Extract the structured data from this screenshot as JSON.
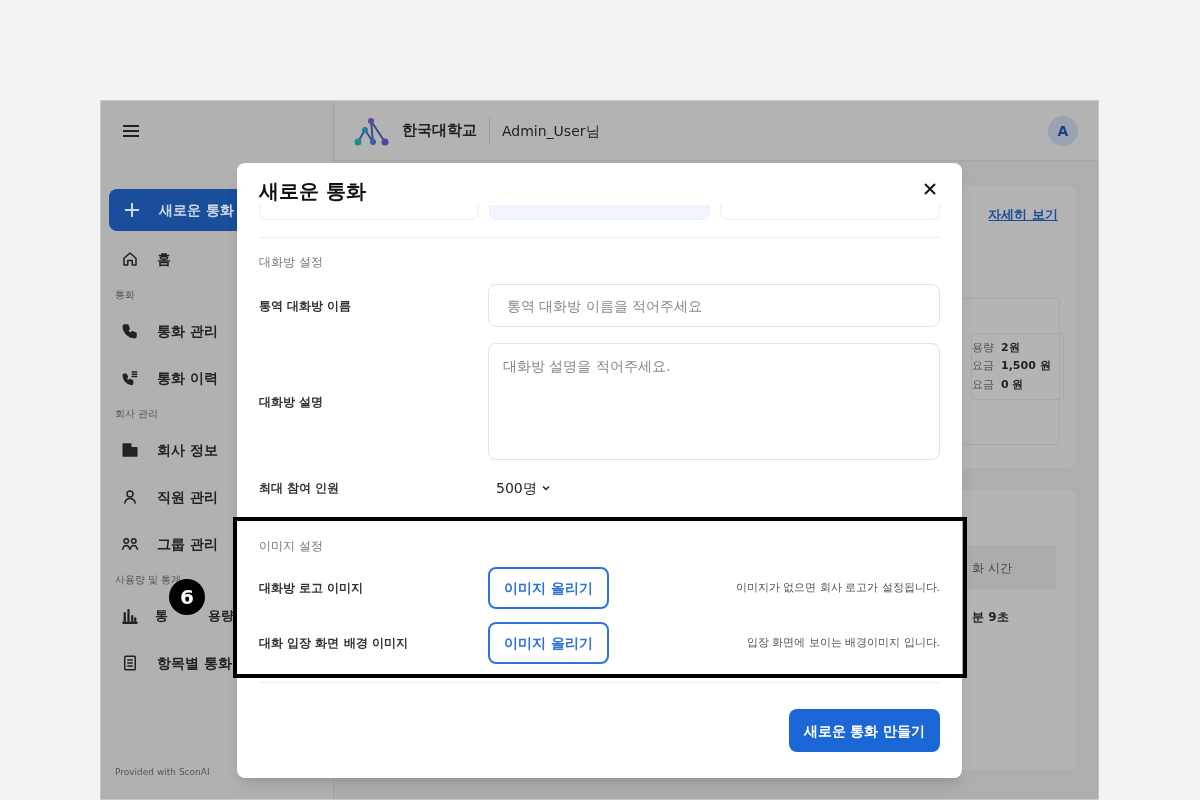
{
  "sidebar": {
    "items": [
      {
        "kind": "primary",
        "label": "새로운 통화"
      },
      {
        "kind": "item",
        "label": "홈"
      },
      {
        "kind": "section",
        "label": "통화"
      },
      {
        "kind": "item",
        "label": "통화 관리"
      },
      {
        "kind": "item",
        "label": "통화 이력"
      },
      {
        "kind": "section",
        "label": "회사 관리"
      },
      {
        "kind": "item",
        "label": "회사 정보"
      },
      {
        "kind": "item",
        "label": "직원 관리"
      },
      {
        "kind": "item",
        "label": "그룹 관리"
      },
      {
        "kind": "section",
        "label": "사용량 및 통계"
      },
      {
        "kind": "split",
        "parts": [
          "통",
          "용량"
        ]
      },
      {
        "kind": "item",
        "label": "항목별 통화"
      }
    ],
    "footer": "Provided with SconAI"
  },
  "header": {
    "org": "한국대학교",
    "user": "Admin_User님",
    "avatar": "A"
  },
  "background": {
    "link": "자세히 보기",
    "fees": [
      {
        "label": "용량",
        "value": "2원"
      },
      {
        "label": "요금",
        "value": "1,500 원"
      },
      {
        "label": "요금",
        "value": "0 원"
      }
    ],
    "duration_label": "화 시간",
    "duration_value": "분 9초"
  },
  "modal": {
    "title": "새로운 통화",
    "sections": [
      {
        "title": "대화방 설정",
        "fields": [
          {
            "kind": "input",
            "label": "통역 대화방 이름",
            "placeholder": "통역 대화방 이름을 적어주세요"
          },
          {
            "kind": "textarea",
            "label": "대화방 설명",
            "placeholder": "대화방 설명을 적어주세요."
          },
          {
            "kind": "select",
            "label": "최대 참여 인원",
            "value": "500명"
          }
        ]
      },
      {
        "title": "이미지 설정",
        "fields": [
          {
            "kind": "upload",
            "label": "대화방 로고 이미지",
            "button": "이미지 올리기",
            "hint": "이미지가 없으면 회사 로고가 설정됩니다."
          },
          {
            "kind": "upload",
            "label": "대화 입장 화면 배경 이미지",
            "button": "이미지 올리기",
            "hint": "입장 화면에 보이는 배경이미지 입니다."
          }
        ]
      }
    ],
    "submit": "새로운 통화 만들기"
  },
  "annotation": {
    "number": "6"
  }
}
